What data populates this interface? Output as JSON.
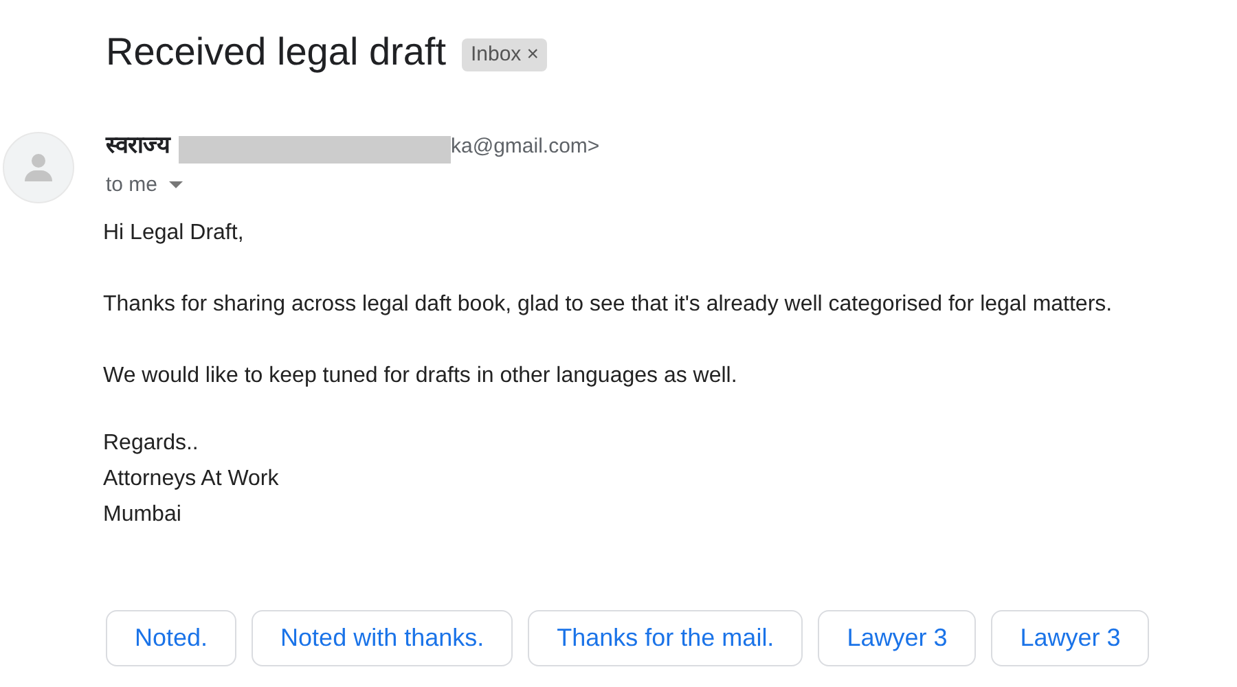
{
  "subject": "Received legal draft",
  "label": {
    "text": "Inbox",
    "remove": "×"
  },
  "sender": {
    "name": "स्वराज्य",
    "email_tail": "ka@gmail.com>"
  },
  "recipient": "to me",
  "body": [
    "Hi Legal Draft,",
    "Thanks for sharing across legal daft book, glad to see that it's already well categorised for legal matters.",
    "We would like to keep tuned for drafts in other languages as well."
  ],
  "signature": [
    "Regards..",
    "Attorneys At Work",
    "Mumbai"
  ],
  "smart_replies": [
    "Noted.",
    "Noted with thanks.",
    "Thanks for the mail.",
    "Lawyer 3",
    "Lawyer 3"
  ]
}
